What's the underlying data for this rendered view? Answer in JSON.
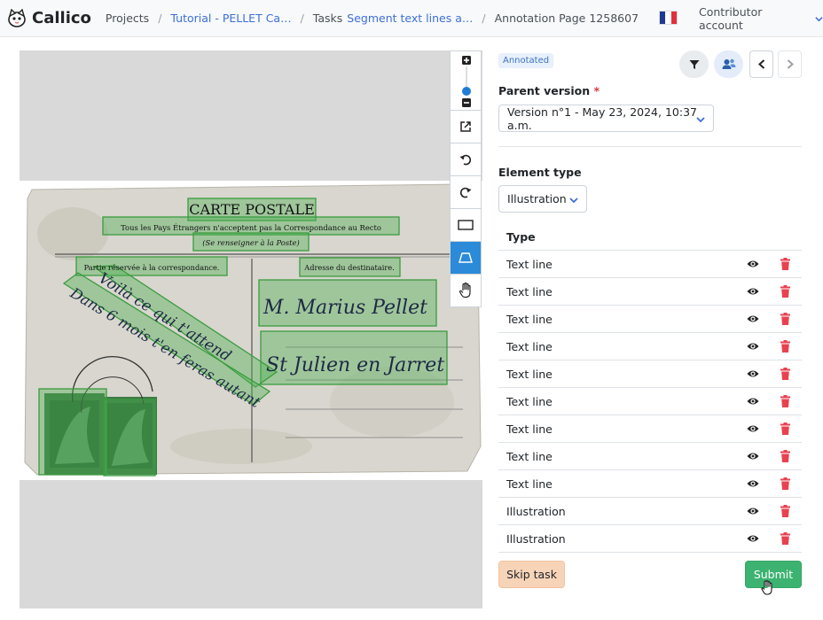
{
  "navbar": {
    "brand": "Callico",
    "breadcrumbs": [
      {
        "label": "Projects",
        "link": false
      },
      {
        "label": "Tutorial - PELLET Ca…",
        "link": true
      },
      {
        "label": "Tasks",
        "link": false
      },
      {
        "label": "Segment text lines a…",
        "link": true
      },
      {
        "label": "Annotation Page 1258607",
        "link": false
      }
    ],
    "language_flag": "fr-flag-icon",
    "account": "Contributor account"
  },
  "viewer": {
    "postcard_title": "CARTE POSTALE",
    "postcard_line1": "Tous les Pays Étrangers n'acceptent pas la Correspondance au Recto",
    "postcard_line2": "(Se renseigner à la Poste)",
    "postcard_left_header": "Partie réservée à la correspondance.",
    "postcard_right_header": "Adresse du destinataire.",
    "handwriting_1": "Voilà ce qui t'attend",
    "handwriting_2": "Dans 6 mois t'en feras autant",
    "address_1": "M. Marius Pellet",
    "address_2": "St Julien en Jarret",
    "overlay_color": "#4caf50"
  },
  "toolbar": {
    "tools": [
      "zoom-in-icon",
      "zoom-slider",
      "zoom-out-icon",
      "external-link-icon",
      "rotate-left-icon",
      "rotate-right-icon",
      "rectangle-icon",
      "polygon-icon",
      "hand-icon"
    ],
    "active_tool": "polygon-icon"
  },
  "panel": {
    "badge": "Annotated",
    "parent_version_label": "Parent version",
    "required_mark": "*",
    "parent_version_value": "Version n°1 - May 23, 2024, 10:37 a.m.",
    "element_type_label": "Element type",
    "element_type_value": "Illustration",
    "table_header": "Type",
    "rows": [
      {
        "type": "Text line"
      },
      {
        "type": "Text line"
      },
      {
        "type": "Text line"
      },
      {
        "type": "Text line"
      },
      {
        "type": "Text line"
      },
      {
        "type": "Text line"
      },
      {
        "type": "Text line"
      },
      {
        "type": "Text line"
      },
      {
        "type": "Text line"
      },
      {
        "type": "Illustration"
      },
      {
        "type": "Illustration"
      }
    ],
    "skip_label": "Skip task",
    "submit_label": "Submit"
  },
  "colors": {
    "accent": "#3c6fd8",
    "active_tool": "#2b8bd9",
    "delete": "#dc3545",
    "submit": "#3cb371",
    "skip": "#f7d3b8"
  }
}
